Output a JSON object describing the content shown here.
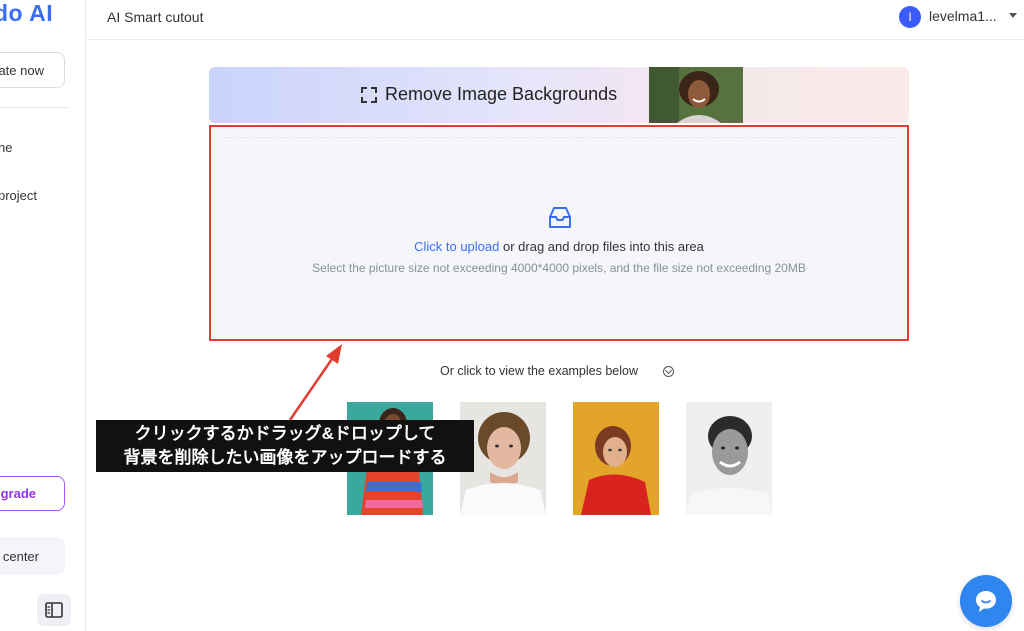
{
  "sidebar": {
    "logo": "do AI",
    "create_button": "ate now",
    "nav_items": [
      {
        "label": "ne"
      },
      {
        "label": "project"
      }
    ],
    "upgrade_button": "grade",
    "help_button": "center"
  },
  "topbar": {
    "page_title": "AI Smart cutout",
    "avatar_initial": "I",
    "username": "levelma1..."
  },
  "banner": {
    "title": "Remove Image Backgrounds"
  },
  "dropzone": {
    "link_text": "Click to upload",
    "instruction_text": " or drag and drop files into this area",
    "hint": "Select the picture size not exceeding 4000*4000 pixels, and the file size not exceeding 20MB"
  },
  "examples": {
    "title": "Or click to view the examples below"
  },
  "annotation": {
    "line1": "クリックするかドラッグ&ドロップして",
    "line2": "背景を削除したい画像をアップロードする"
  },
  "colors": {
    "accent": "#3b6ef6",
    "highlight_border": "#e23b30",
    "upgrade": "#a855f7",
    "chat": "#2f86ee"
  }
}
